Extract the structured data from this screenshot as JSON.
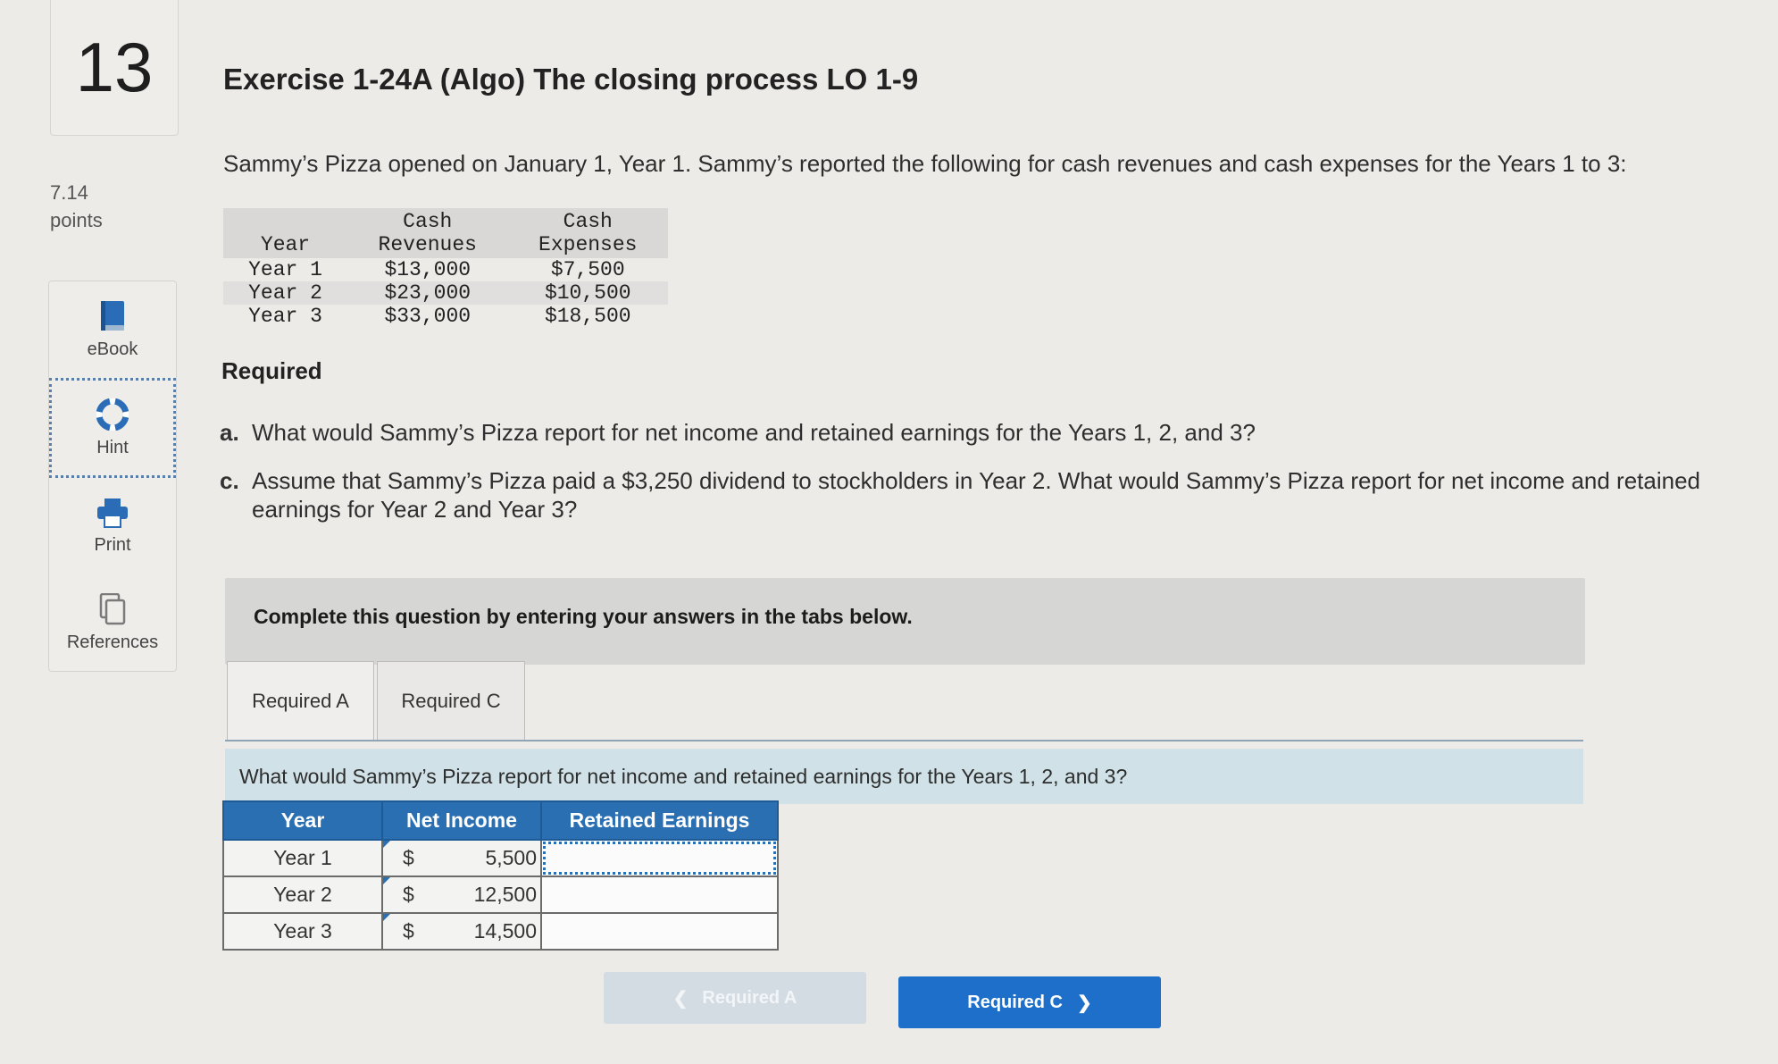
{
  "question": {
    "number": "13",
    "points_value": "7.14",
    "points_label": "points"
  },
  "tools": [
    {
      "label": "eBook",
      "icon": "book-icon"
    },
    {
      "label": "Hint",
      "icon": "lifebuoy-icon"
    },
    {
      "label": "Print",
      "icon": "printer-icon"
    },
    {
      "label": "References",
      "icon": "documents-icon"
    }
  ],
  "exercise": {
    "title": "Exercise 1-24A (Algo) The closing process LO 1-9",
    "intro": "Sammy’s Pizza opened on January 1, Year 1. Sammy’s reported the following for cash revenues and cash expenses for the Years 1 to 3:"
  },
  "data_table": {
    "headers": {
      "year": "Year",
      "revenues_1": "Cash",
      "revenues_2": "Revenues",
      "expenses_1": "Cash",
      "expenses_2": "Expenses"
    },
    "rows": [
      {
        "year": "Year 1",
        "revenues": "$13,000",
        "expenses": "$7,500"
      },
      {
        "year": "Year 2",
        "revenues": "$23,000",
        "expenses": "$10,500"
      },
      {
        "year": "Year 3",
        "revenues": "$33,000",
        "expenses": "$18,500"
      }
    ]
  },
  "required": {
    "heading": "Required",
    "items": [
      {
        "label": "a.",
        "text": "What would Sammy’s Pizza report for net income and retained earnings for the Years 1, 2, and 3?"
      },
      {
        "label": "c.",
        "text": "Assume that Sammy’s Pizza paid a $3,250 dividend to stockholders in Year 2. What would Sammy’s Pizza report for net income and retained earnings for Year 2 and Year 3?"
      }
    ]
  },
  "instructions": "Complete this question by entering your answers in the tabs below.",
  "tabs": [
    {
      "label": "Required A",
      "active": true
    },
    {
      "label": "Required C",
      "active": false
    }
  ],
  "tab_prompt": "What would Sammy’s Pizza report for net income and retained earnings for the Years 1, 2, and 3?",
  "answer_table": {
    "headers": {
      "year": "Year",
      "net_income": "Net Income",
      "retained_earnings": "Retained Earnings"
    },
    "rows": [
      {
        "year": "Year 1",
        "currency": "$",
        "net_income": "5,500",
        "retained_earnings": ""
      },
      {
        "year": "Year 2",
        "currency": "$",
        "net_income": "12,500",
        "retained_earnings": ""
      },
      {
        "year": "Year 3",
        "currency": "$",
        "net_income": "14,500",
        "retained_earnings": ""
      }
    ]
  },
  "nav": {
    "prev_label": "Required A",
    "next_label": "Required C"
  },
  "colors": {
    "accent": "#1d6fc9",
    "table_header": "#2b6fb3",
    "prompt_bg": "#d0e2e8"
  }
}
